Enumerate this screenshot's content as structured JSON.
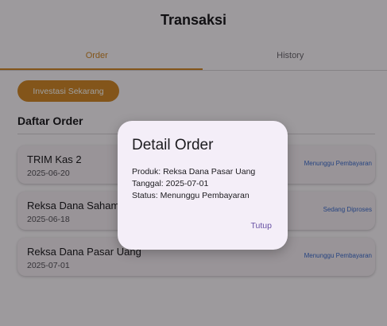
{
  "app_bar": {
    "title": "Transaksi"
  },
  "tabs": [
    {
      "label": "Order",
      "active": true
    },
    {
      "label": "History",
      "active": false
    }
  ],
  "invest_button": {
    "label": "Investasi Sekarang"
  },
  "section": {
    "title": "Daftar Order"
  },
  "orders": [
    {
      "product": "TRIM Kas 2",
      "date": "2025-06-20",
      "status": "Menunggu Pembayaran",
      "status_color": "#3f6fd0"
    },
    {
      "product": "Reksa Dana Saham",
      "date": "2025-06-18",
      "status": "Sedang Diproses",
      "status_color": "#3f6fd0"
    },
    {
      "product": "Reksa Dana Pasar Uang",
      "date": "2025-07-01",
      "status": "Menunggu Pembayaran",
      "status_color": "#3f6fd0"
    }
  ],
  "dialog": {
    "title": "Detail Order",
    "lines": [
      "Produk: Reksa Dana Pasar Uang",
      "Tanggal: 2025-07-01",
      "Status: Menunggu Pembayaran"
    ],
    "close_label": "Tutup"
  },
  "colors": {
    "accent": "#d38a2a",
    "link": "#6750a4",
    "divider": "#d8d2d8"
  }
}
